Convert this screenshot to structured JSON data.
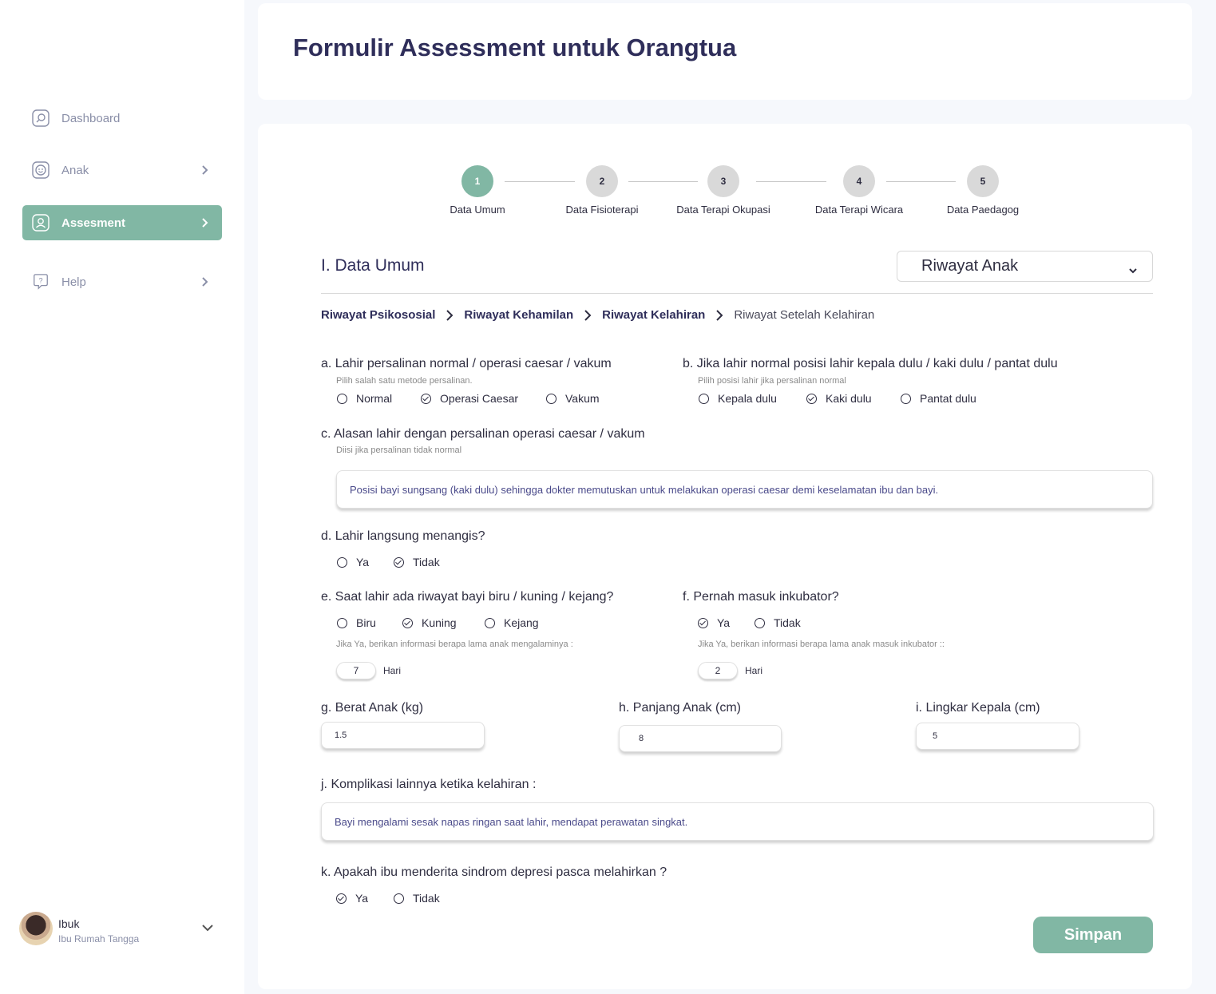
{
  "sidebar": {
    "items": [
      {
        "label": "Dashboard",
        "icon": "dashboard-icon"
      },
      {
        "label": "Anak",
        "icon": "child-icon"
      },
      {
        "label": "Assesment",
        "icon": "user-icon"
      },
      {
        "label": "Help",
        "icon": "help-icon"
      }
    ],
    "active_color": "#81b7a4"
  },
  "profile": {
    "name": "Ibuk",
    "role": "Ibu Rumah Tangga"
  },
  "header": {
    "title": "Formulir Assessment untuk Orangtua"
  },
  "stepper": {
    "steps": [
      {
        "number": "1",
        "label": "Data Umum",
        "active": true
      },
      {
        "number": "2",
        "label": "Data Fisioterapi",
        "active": false
      },
      {
        "number": "3",
        "label": "Data Terapi Okupasi",
        "active": false
      },
      {
        "number": "4",
        "label": "Data Terapi Wicara",
        "active": false
      },
      {
        "number": "5",
        "label": "Data Paedagog",
        "active": false
      }
    ]
  },
  "section": {
    "title": "I. Data Umum",
    "select_value": "Riwayat Anak"
  },
  "breadcrumb": [
    "Riwayat Psikososial",
    "Riwayat Kehamilan",
    "Riwayat Kelahiran",
    "Riwayat Setelah Kelahiran"
  ],
  "form": {
    "a": {
      "question": "a. Lahir persalinan normal / operasi caesar / vakum",
      "hint": "Pilih salah satu metode persalinan.",
      "options": [
        "Normal",
        "Operasi Caesar",
        "Vakum"
      ],
      "selected": "Operasi Caesar"
    },
    "b": {
      "question": "b. Jika lahir normal posisi lahir kepala dulu / kaki dulu / pantat dulu",
      "hint": "Pilih posisi lahir jika persalinan normal",
      "options": [
        "Kepala dulu",
        "Kaki dulu",
        "Pantat dulu"
      ],
      "selected": "Kaki dulu"
    },
    "c": {
      "question": "c. Alasan lahir dengan persalinan operasi caesar / vakum",
      "hint": "Diisi jika persalinan tidak normal",
      "value": "Posisi bayi sungsang (kaki dulu) sehingga dokter memutuskan untuk melakukan operasi caesar demi keselamatan ibu dan bayi."
    },
    "d": {
      "question": "d. Lahir langsung menangis?",
      "options": [
        "Ya",
        "Tidak"
      ],
      "selected": "Tidak"
    },
    "e": {
      "question": "e. Saat lahir ada riwayat bayi biru / kuning / kejang?",
      "options": [
        "Biru",
        "Kuning",
        "Kejang"
      ],
      "selected": "Kuning",
      "hint": "Jika Ya, berikan informasi berapa lama anak mengalaminya :",
      "value": "7",
      "unit": "Hari"
    },
    "f": {
      "question": "f. Pernah masuk inkubator?",
      "options": [
        "Ya",
        "Tidak"
      ],
      "selected": "Ya",
      "hint": "Jika Ya, berikan informasi berapa lama anak masuk inkubator ::",
      "value": "2",
      "unit": "Hari"
    },
    "g": {
      "question": "g. Berat Anak (kg)",
      "value": "1.5"
    },
    "h": {
      "question": "h. Panjang Anak (cm)",
      "value": "8"
    },
    "i": {
      "question": "i. Lingkar Kepala (cm)",
      "value": "5"
    },
    "j": {
      "question": "j. Komplikasi lainnya ketika kelahiran :",
      "value": "Bayi mengalami sesak napas ringan saat lahir, mendapat perawatan singkat."
    },
    "k": {
      "question": "k. Apakah ibu menderita sindrom depresi pasca melahirkan ?",
      "options": [
        "Ya",
        "Tidak"
      ],
      "selected": "Ya"
    }
  },
  "buttons": {
    "save": "Simpan"
  }
}
